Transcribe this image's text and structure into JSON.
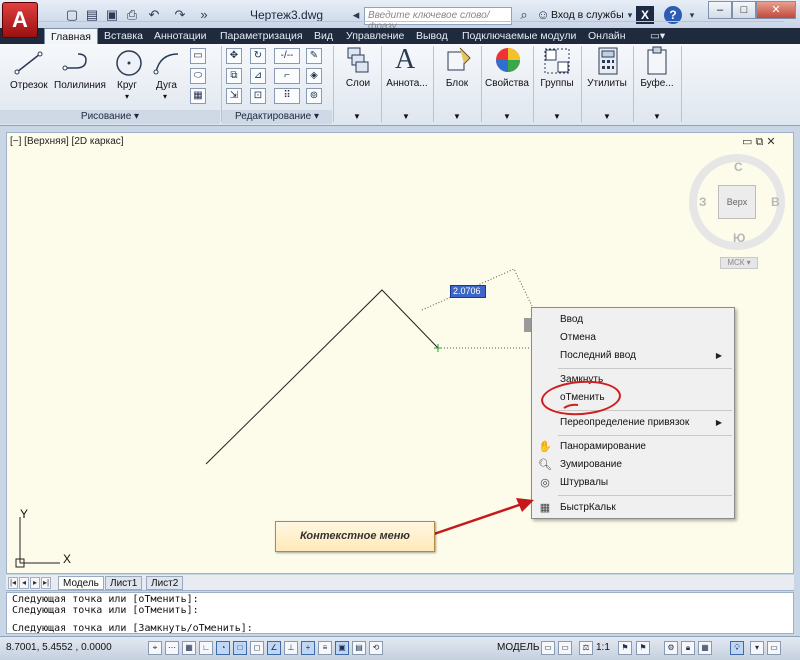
{
  "window": {
    "app_logo": "A",
    "doc_title": "Чертеж3.dwg",
    "search_placeholder": "Введите ключевое слово/фразу",
    "sign_in": "Вход в службы",
    "help": "?",
    "minimize": "–",
    "maximize": "□",
    "close": "✕"
  },
  "quick_access": [
    "new-icon",
    "open-icon",
    "save-icon",
    "saveas-icon",
    "print-icon",
    "undo-icon",
    "redo-icon",
    "more-icon"
  ],
  "tabs": [
    "Главная",
    "Вставка",
    "Аннотации",
    "Параметризация",
    "Вид",
    "Управление",
    "Вывод",
    "Подключаемые модули",
    "Онлайн"
  ],
  "active_tab": "Главная",
  "ribbon": {
    "draw": {
      "title": "Рисование",
      "line": "Отрезок",
      "polyline": "Полилиния",
      "circle": "Круг",
      "arc": "Дуга"
    },
    "modify": {
      "title": "Редактирование"
    },
    "big_tools": [
      {
        "label": "Слои",
        "icon": "layers-icon"
      },
      {
        "label": "Аннота...",
        "icon": "annotation-icon"
      },
      {
        "label": "Блок",
        "icon": "block-icon"
      },
      {
        "label": "Свойства",
        "icon": "properties-icon"
      },
      {
        "label": "Группы",
        "icon": "groups-icon"
      },
      {
        "label": "Утилиты",
        "icon": "utilities-icon"
      },
      {
        "label": "Буфе...",
        "icon": "clipboard-icon"
      }
    ]
  },
  "viewport": {
    "label": "[−] [Верхняя] [2D каркас]",
    "dim_value": "2.0706"
  },
  "viewcube": {
    "north": "С",
    "south": "Ю",
    "west": "З",
    "east": "В",
    "face": "Верх",
    "wcs": "МСК"
  },
  "ucs": {
    "x": "X",
    "y": "Y"
  },
  "context_menu": {
    "items": [
      {
        "label": "Ввод",
        "submenu": false
      },
      {
        "label": "Отмена",
        "submenu": false
      },
      {
        "label": "Последний ввод",
        "submenu": true
      },
      {
        "label": "Замкнуть",
        "submenu": false
      },
      {
        "label": "оТменить",
        "submenu": false
      },
      {
        "label": "Переопределение привязок",
        "submenu": true
      },
      {
        "label": "Панорамирование",
        "submenu": false,
        "icon": "pan-icon"
      },
      {
        "label": "Зумирование",
        "submenu": false,
        "icon": "zoom-icon"
      },
      {
        "label": "Штурвалы",
        "submenu": false,
        "icon": "steeringwheel-icon"
      },
      {
        "label": "БыстрКальк",
        "submenu": false,
        "icon": "calculator-icon"
      }
    ]
  },
  "callout": {
    "text": "Контекстное меню"
  },
  "layout_tabs": [
    "Модель",
    "Лист1",
    "Лист2"
  ],
  "command": {
    "history": [
      "Следующая точка или [оТменить]:",
      "Следующая точка или [оТменить]:"
    ],
    "prompt": "Следующая точка или [Замкнуть/оТменить]:"
  },
  "statusbar": {
    "coords": "8.7001, 5.4552 , 0.0000",
    "model": "МОДЕЛЬ",
    "scale": "1:1"
  },
  "colors": {
    "accent": "#3e66c8",
    "highlight_circle": "#d01d1d",
    "canvas": "#fdfbe9"
  }
}
